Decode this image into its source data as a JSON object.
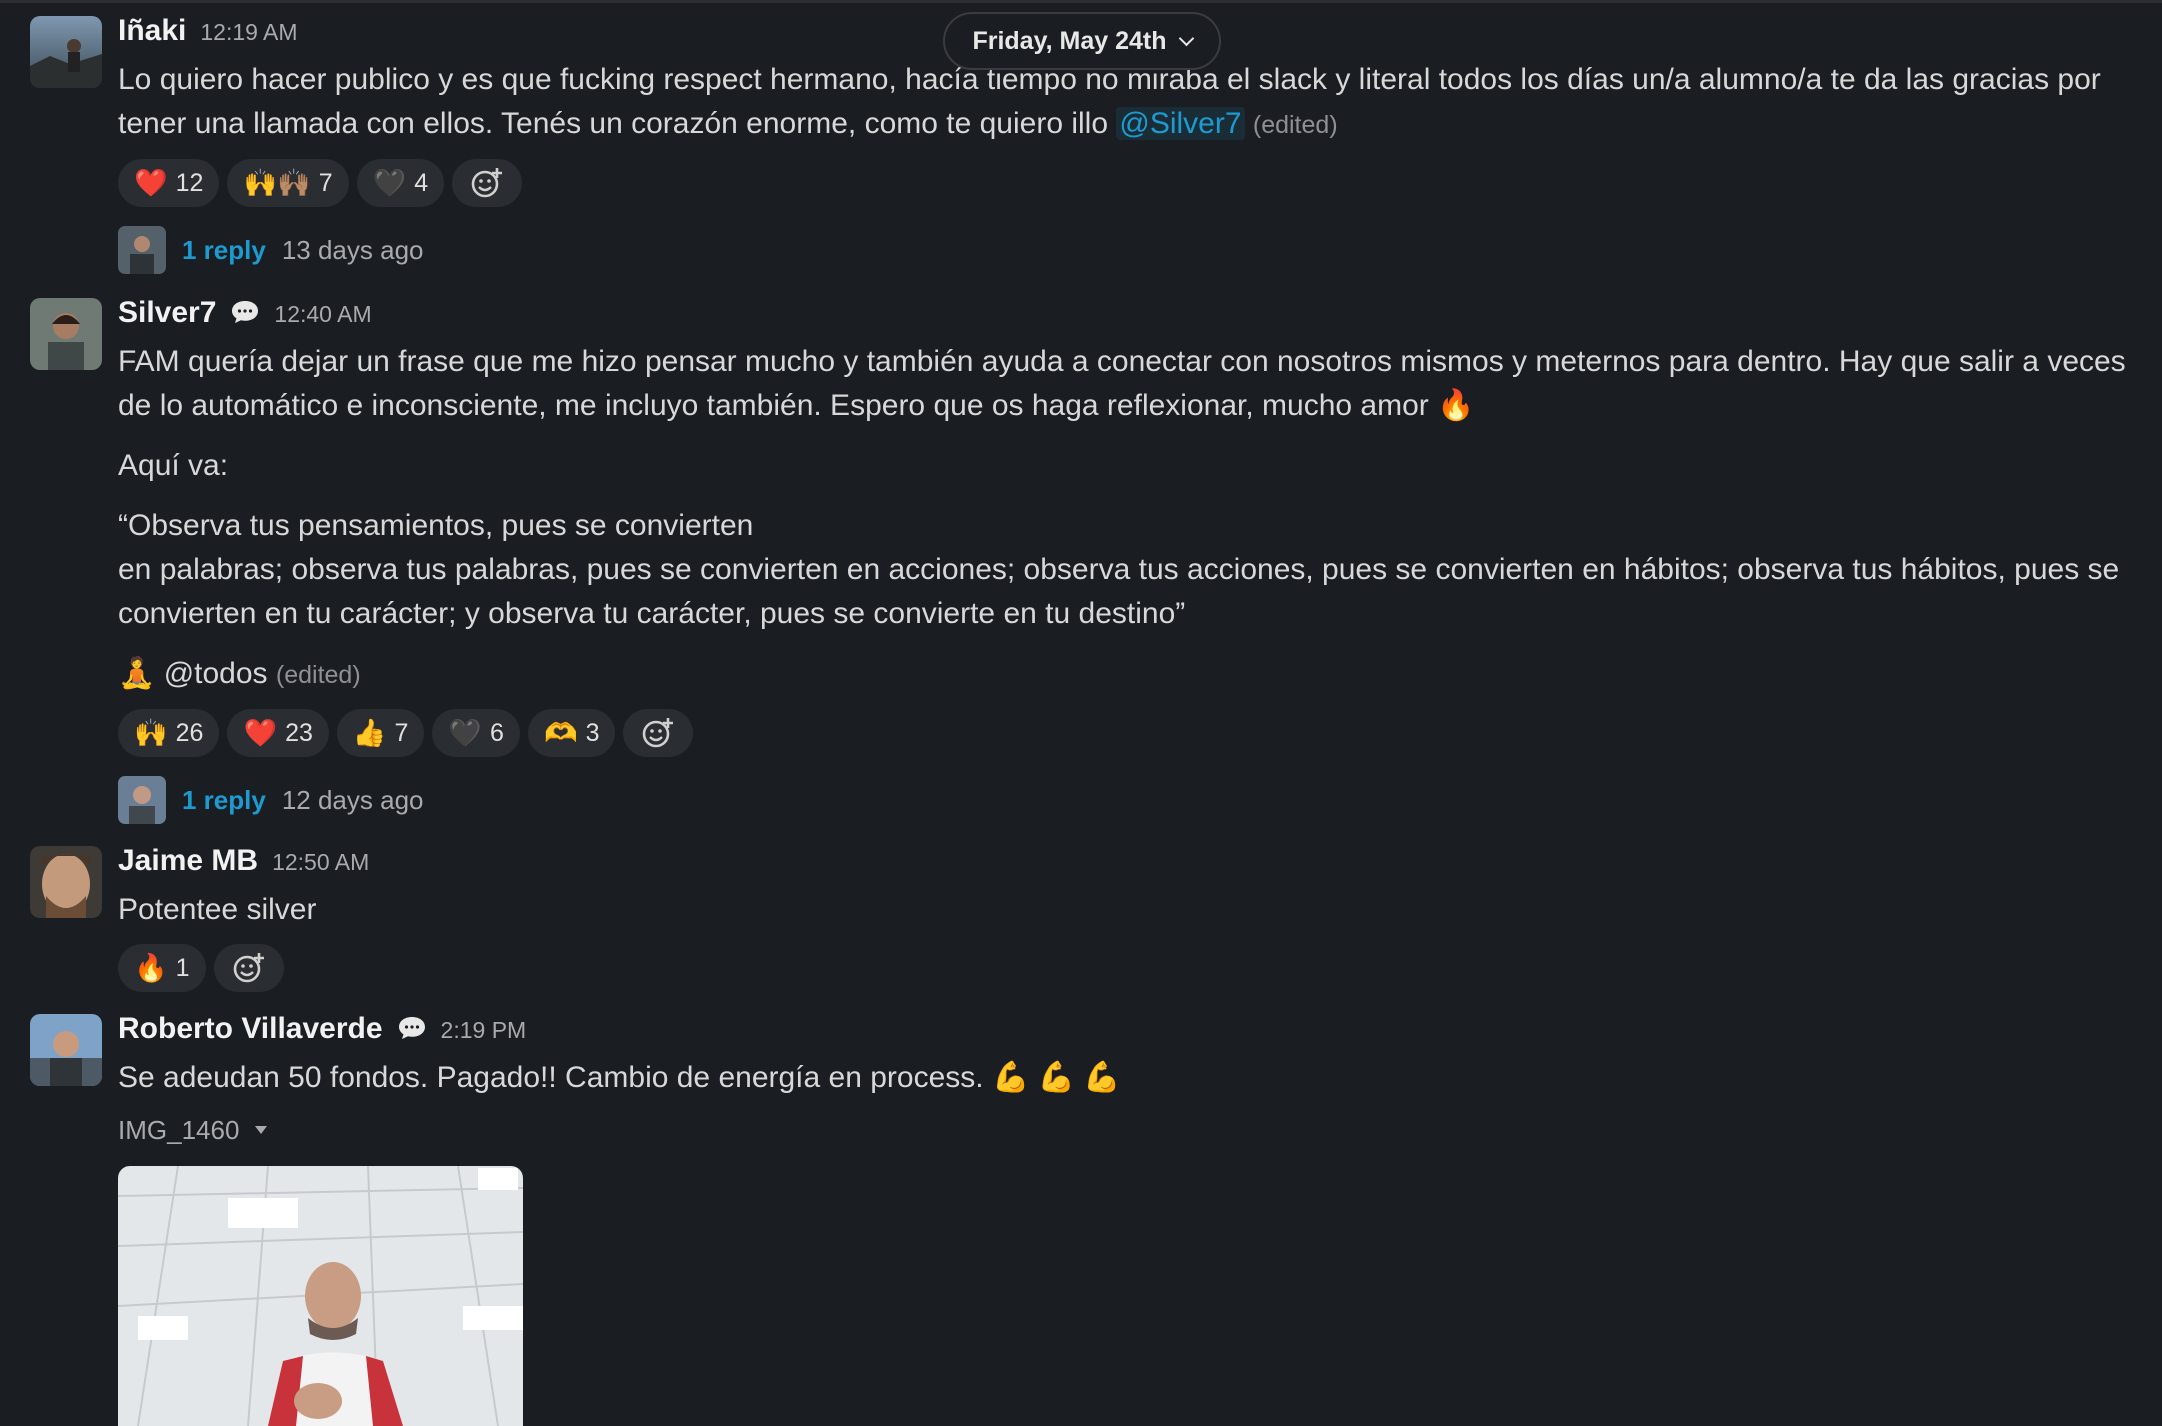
{
  "date_divider": {
    "label": "Friday, May 24th"
  },
  "messages": [
    {
      "author": "Iñaki",
      "time": "12:19 AM",
      "text": "Lo quiero hacer publico y es que fucking respect hermano, hacía tiempo no miraba el slack y literal todos los días un/a alumno/a te da las gracias por tener una llamada con ellos. Tenés un corazón enorme, como te quiero illo",
      "mention": "@Silver7",
      "edited": "(edited)",
      "reactions": [
        {
          "emoji": "❤️",
          "count": "12"
        },
        {
          "emoji": "🙌🙌🏽",
          "count": "7"
        },
        {
          "emoji": "🖤",
          "count": "4"
        }
      ],
      "thread": {
        "replies": "1 reply",
        "ago": "13 days ago"
      }
    },
    {
      "author": "Silver7",
      "time": "12:40 AM",
      "text": "FAM quería dejar un frase que me hizo pensar mucho y también ayuda a conectar con nosotros mismos y meternos para dentro. Hay que salir a veces de lo automático e inconsciente, me incluyo también. Espero que os haga reflexionar, mucho amor",
      "text_emoji": "🔥",
      "intro": "Aquí va:",
      "quote_line1": "“Observa tus pensamientos, pues se convierten",
      "quote_line2": "en palabras; observa tus palabras, pues se convierten en acciones; observa tus acciones, pues se convierten en hábitos; observa tus hábitos, pues se convierten en tu carácter; y observa tu carácter, pues se convierte en tu destino”",
      "closing_emoji": "🧘",
      "closing": "@todos",
      "edited": "(edited)",
      "reactions": [
        {
          "emoji": "🙌",
          "count": "26"
        },
        {
          "emoji": "❤️",
          "count": "23"
        },
        {
          "emoji": "👍",
          "count": "7"
        },
        {
          "emoji": "🖤",
          "count": "6"
        },
        {
          "emoji": "🫶",
          "count": "3"
        }
      ],
      "thread": {
        "replies": "1 reply",
        "ago": "12 days ago"
      }
    },
    {
      "author": "Jaime MB",
      "time": "12:50 AM",
      "text": "Potentee silver",
      "reactions": [
        {
          "emoji": "🔥",
          "count": "1"
        }
      ]
    },
    {
      "author": "Roberto Villaverde",
      "time": "2:19 PM",
      "text": "Se adeudan 50 fondos. Pagado!! Cambio de energía en process.",
      "text_emoji": "💪 💪 💪",
      "file_name": "IMG_1460"
    }
  ],
  "icons": [
    "avatar",
    "chat-bubble-icon",
    "add-reaction-icon",
    "chevron-down-icon",
    "caret-down-icon"
  ],
  "colors": {
    "background": "#1a1d21",
    "link": "#1d9bd1",
    "reaction_bg": "#2a2d31"
  }
}
